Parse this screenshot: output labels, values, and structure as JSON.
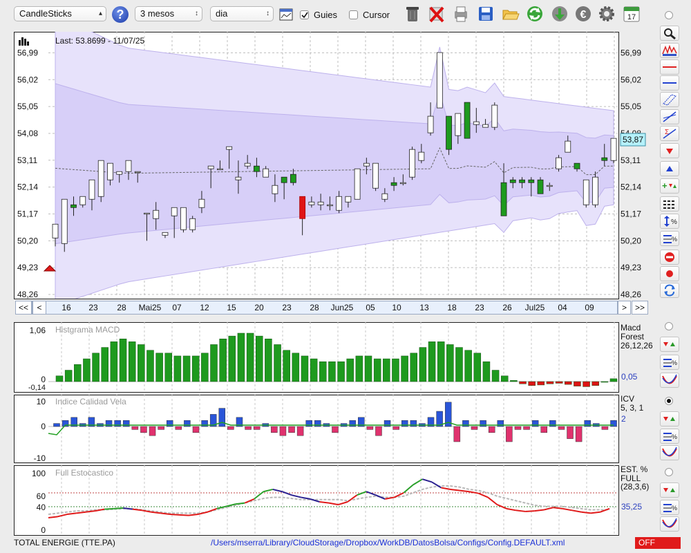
{
  "toolbar": {
    "chart_type": "CandleSticks",
    "period": "3 mesos",
    "interval": "dia",
    "guides_label": "Guies",
    "guides_checked": true,
    "cursor_label": "Cursor",
    "cursor_checked": false,
    "help_icon": "question-icon",
    "calendar_day": "17"
  },
  "main_chart": {
    "last_label": "Last: 53.8699 - 11/07/25",
    "current_price_label": "53,87",
    "y_ticks": [
      "56,99",
      "56,02",
      "55,05",
      "54,08",
      "53,11",
      "52,14",
      "51,17",
      "50,20",
      "49,23",
      "48,26"
    ],
    "x_ticks": [
      "16",
      "23",
      "28",
      "Mai25",
      "07",
      "12",
      "15",
      "20",
      "23",
      "28",
      "Jun25",
      "05",
      "10",
      "13",
      "18",
      "23",
      "26",
      "Jul25",
      "04",
      "09"
    ],
    "nav": {
      "first": "<<",
      "prev": "<",
      "next": ">",
      "last": ">>"
    }
  },
  "macd_panel": {
    "title": "Histgrama MACD",
    "legend_name": "Macd Forest",
    "legend_params": "26,12,26",
    "current_value": "0,05",
    "y_top": "1,06",
    "y_zero": "0",
    "y_min": "-0,14"
  },
  "icv_panel": {
    "title": "Indice Calidad Vela",
    "legend_name": "ICV",
    "legend_params": "5, 3, 1",
    "current_value": "2",
    "y_ticks": [
      "10",
      "0",
      "-10"
    ]
  },
  "stoch_panel": {
    "title": "Full Estocastico",
    "legend_name": "EST. % FULL",
    "legend_params": "(28,3,6)",
    "current_value": "35,25",
    "y_ticks": [
      "100",
      "60",
      "40",
      "0"
    ]
  },
  "status": {
    "instrument": "TOTAL ENERGIE (TTE.PA)",
    "config_path": "/Users/mserra/Library/CloudStorage/Dropbox/WorkDB/DatosBolsa/Configs/Config.DEFAULT.xml",
    "state": "OFF"
  },
  "colors": {
    "up": "#1e9a1e",
    "down": "#e01414",
    "band": "#e6e1fa",
    "hist_up": "#1e9a1e",
    "hist_down": "#dd1414",
    "icv_up": "#2a55d8",
    "icv_down": "#e0326e"
  },
  "chart_data": [
    {
      "type": "candlestick",
      "title": "",
      "ylim": [
        48.26,
        57.5
      ],
      "x": [
        "16",
        "23",
        "28",
        "Mai25",
        "07",
        "12",
        "15",
        "20",
        "23",
        "28",
        "Jun25",
        "05",
        "10",
        "13",
        "18",
        "23",
        "26",
        "Jul25",
        "04",
        "09"
      ],
      "candles": [
        [
          50.3,
          50.8,
          50.0,
          50.1
        ],
        [
          50.1,
          51.7,
          49.8,
          51.7
        ],
        [
          51.5,
          51.4,
          51.1,
          51.8
        ],
        [
          51.5,
          51.8,
          51.4,
          51.7
        ],
        [
          51.7,
          52.4,
          51.3,
          51.5
        ],
        [
          51.8,
          53.1,
          51.6,
          52.4
        ],
        [
          52.4,
          53.0,
          52.2,
          52.6
        ],
        [
          52.6,
          52.7,
          52.3,
          52.6
        ],
        [
          52.7,
          53.1,
          52.4,
          53.0
        ],
        [
          52.7,
          52.7,
          52.3,
          52.4
        ],
        [
          51.2,
          51.2,
          50.2,
          51.0
        ],
        [
          51.0,
          51.3,
          50.6,
          51.6
        ],
        [
          50.4,
          50.5,
          50.3,
          50.5
        ],
        [
          51.1,
          51.4,
          50.3,
          50.9
        ],
        [
          50.6,
          51.4,
          50.5,
          51.0
        ],
        [
          50.6,
          51.0,
          50.5,
          51.1
        ],
        [
          51.4,
          51.7,
          51.2,
          52.0
        ],
        [
          52.8,
          52.9,
          52.1,
          52.8
        ],
        [
          52.8,
          52.8,
          53.1,
          53.1
        ],
        [
          53.5,
          53.6,
          52.8,
          53.6
        ],
        [
          52.4,
          52.5,
          51.9,
          53.1
        ],
        [
          52.9,
          53.0,
          52.8,
          53.3
        ],
        [
          52.9,
          52.7,
          52.5,
          53.2
        ],
        [
          52.5,
          52.8,
          52.6,
          52.9
        ],
        [
          51.9,
          52.2,
          51.6,
          52.6
        ],
        [
          52.5,
          52.3,
          51.7,
          52.0
        ],
        [
          52.6,
          52.3,
          52.2,
          52.8
        ],
        [
          51.8,
          51.0,
          50.4,
          51.8
        ],
        [
          51.5,
          51.6,
          51.4,
          51.8
        ],
        [
          51.5,
          51.6,
          51.3,
          51.9
        ],
        [
          51.5,
          51.5,
          51.3,
          51.8
        ],
        [
          51.3,
          51.8,
          51.2,
          52.0
        ],
        [
          51.6,
          51.8,
          51.4,
          51.8
        ],
        [
          51.7,
          52.8,
          51.8,
          52.8
        ],
        [
          52.9,
          53.0,
          52.6,
          53.2
        ],
        [
          52.1,
          53.0,
          52.0,
          53.0
        ],
        [
          51.7,
          51.9,
          51.6,
          52.1
        ],
        [
          52.3,
          52.2,
          52.0,
          52.5
        ],
        [
          52.3,
          52.3,
          52.2,
          52.6
        ],
        [
          52.5,
          53.5,
          52.4,
          53.6
        ],
        [
          53.1,
          53.4,
          53.0,
          53.7
        ],
        [
          54.1,
          54.7,
          54.0,
          55.2
        ],
        [
          55.0,
          57.0,
          55.1,
          56.8
        ],
        [
          54.7,
          53.5,
          53.3,
          54.1
        ],
        [
          54.0,
          54.8,
          53.7,
          54.5
        ],
        [
          55.2,
          53.9,
          53.9,
          55.0
        ],
        [
          54.4,
          54.5,
          54.1,
          55.0
        ],
        [
          54.3,
          54.4,
          54.3,
          54.6
        ],
        [
          54.3,
          55.1,
          54.2,
          55.2
        ],
        [
          52.3,
          51.1,
          51.1,
          53.0
        ],
        [
          52.4,
          52.3,
          52.1,
          52.5
        ],
        [
          52.4,
          52.3,
          52.1,
          52.5
        ],
        [
          52.4,
          52.3,
          51.8,
          52.5
        ],
        [
          52.4,
          51.9,
          51.9,
          52.5
        ],
        [
          52.2,
          52.2,
          52.0,
          52.3
        ],
        [
          52.8,
          53.2,
          52.7,
          53.3
        ],
        [
          53.4,
          53.8,
          53.4,
          54.0
        ],
        [
          53.0,
          52.8,
          52.7,
          53.0
        ],
        [
          51.5,
          52.4,
          51.4,
          52.4
        ],
        [
          51.5,
          52.5,
          51.4,
          52.7
        ],
        [
          53.2,
          53.1,
          52.9,
          53.7
        ],
        [
          53.1,
          53.9,
          53.0,
          53.9
        ]
      ],
      "bollinger": {
        "upper_start": 57.5,
        "upper_end": 54.9,
        "lower_start": 48.3,
        "lower_end": 51.5
      }
    },
    {
      "type": "bar",
      "title": "Histgrama MACD",
      "ylim": [
        -0.14,
        1.06
      ],
      "values": [
        0.1,
        0.2,
        0.3,
        0.4,
        0.5,
        0.6,
        0.7,
        0.75,
        0.7,
        0.65,
        0.55,
        0.5,
        0.5,
        0.45,
        0.45,
        0.45,
        0.5,
        0.65,
        0.75,
        0.8,
        0.85,
        0.85,
        0.8,
        0.75,
        0.65,
        0.55,
        0.5,
        0.45,
        0.4,
        0.35,
        0.35,
        0.35,
        0.4,
        0.45,
        0.45,
        0.4,
        0.4,
        0.4,
        0.45,
        0.5,
        0.6,
        0.7,
        0.7,
        0.65,
        0.6,
        0.55,
        0.5,
        0.35,
        0.2,
        0.1,
        0.02,
        -0.04,
        -0.07,
        -0.06,
        -0.04,
        -0.03,
        -0.05,
        -0.08,
        -0.09,
        -0.07,
        0.0,
        0.05
      ]
    },
    {
      "type": "bar",
      "title": "Indice Calidad Vela",
      "ylim": [
        -10,
        10
      ],
      "values": [
        1,
        2,
        3,
        1,
        3,
        1,
        2,
        2,
        2,
        -1,
        -2,
        -3,
        -1,
        2,
        -1,
        2,
        -2,
        2,
        4,
        6,
        -1,
        3,
        -1,
        -1,
        1,
        -2,
        -3,
        -2,
        -3,
        2,
        2,
        1,
        -2,
        1,
        2,
        3,
        -1,
        -3,
        2,
        -1,
        2,
        2,
        1,
        3,
        5,
        8,
        -5,
        2,
        -1,
        2,
        -2,
        2,
        -5,
        -1,
        -1,
        2,
        -2,
        2,
        -1,
        -4,
        -5,
        2,
        1,
        -1,
        2
      ]
    },
    {
      "type": "line",
      "title": "Full Estocastico",
      "ylim": [
        0,
        100
      ],
      "series": [
        {
          "values": [
            22,
            24,
            28,
            30,
            32,
            34,
            37,
            38,
            39,
            37,
            35,
            32,
            30,
            28,
            27,
            26,
            28,
            32,
            38,
            42,
            46,
            48,
            55,
            68,
            72,
            68,
            62,
            58,
            55,
            50,
            48,
            45,
            50,
            62,
            68,
            62,
            55,
            58,
            66,
            80,
            90,
            85,
            75,
            72,
            70,
            68,
            65,
            58,
            45,
            38,
            35,
            33,
            34,
            36,
            40,
            38,
            35,
            32,
            30,
            32,
            38
          ]
        },
        {
          "values": [
            28,
            30,
            32,
            34,
            34,
            36,
            36,
            37,
            38,
            38,
            36,
            34,
            32,
            30,
            30,
            30,
            30,
            32,
            36,
            40,
            44,
            48,
            52,
            56,
            58,
            58,
            56,
            54,
            54,
            54,
            54,
            54,
            52,
            55,
            58,
            60,
            58,
            58,
            60,
            66,
            72,
            76,
            78,
            78,
            76,
            72,
            70,
            66,
            60,
            56,
            52,
            48,
            44,
            42,
            42,
            42,
            40,
            38,
            36,
            36,
            36
          ]
        }
      ]
    }
  ]
}
